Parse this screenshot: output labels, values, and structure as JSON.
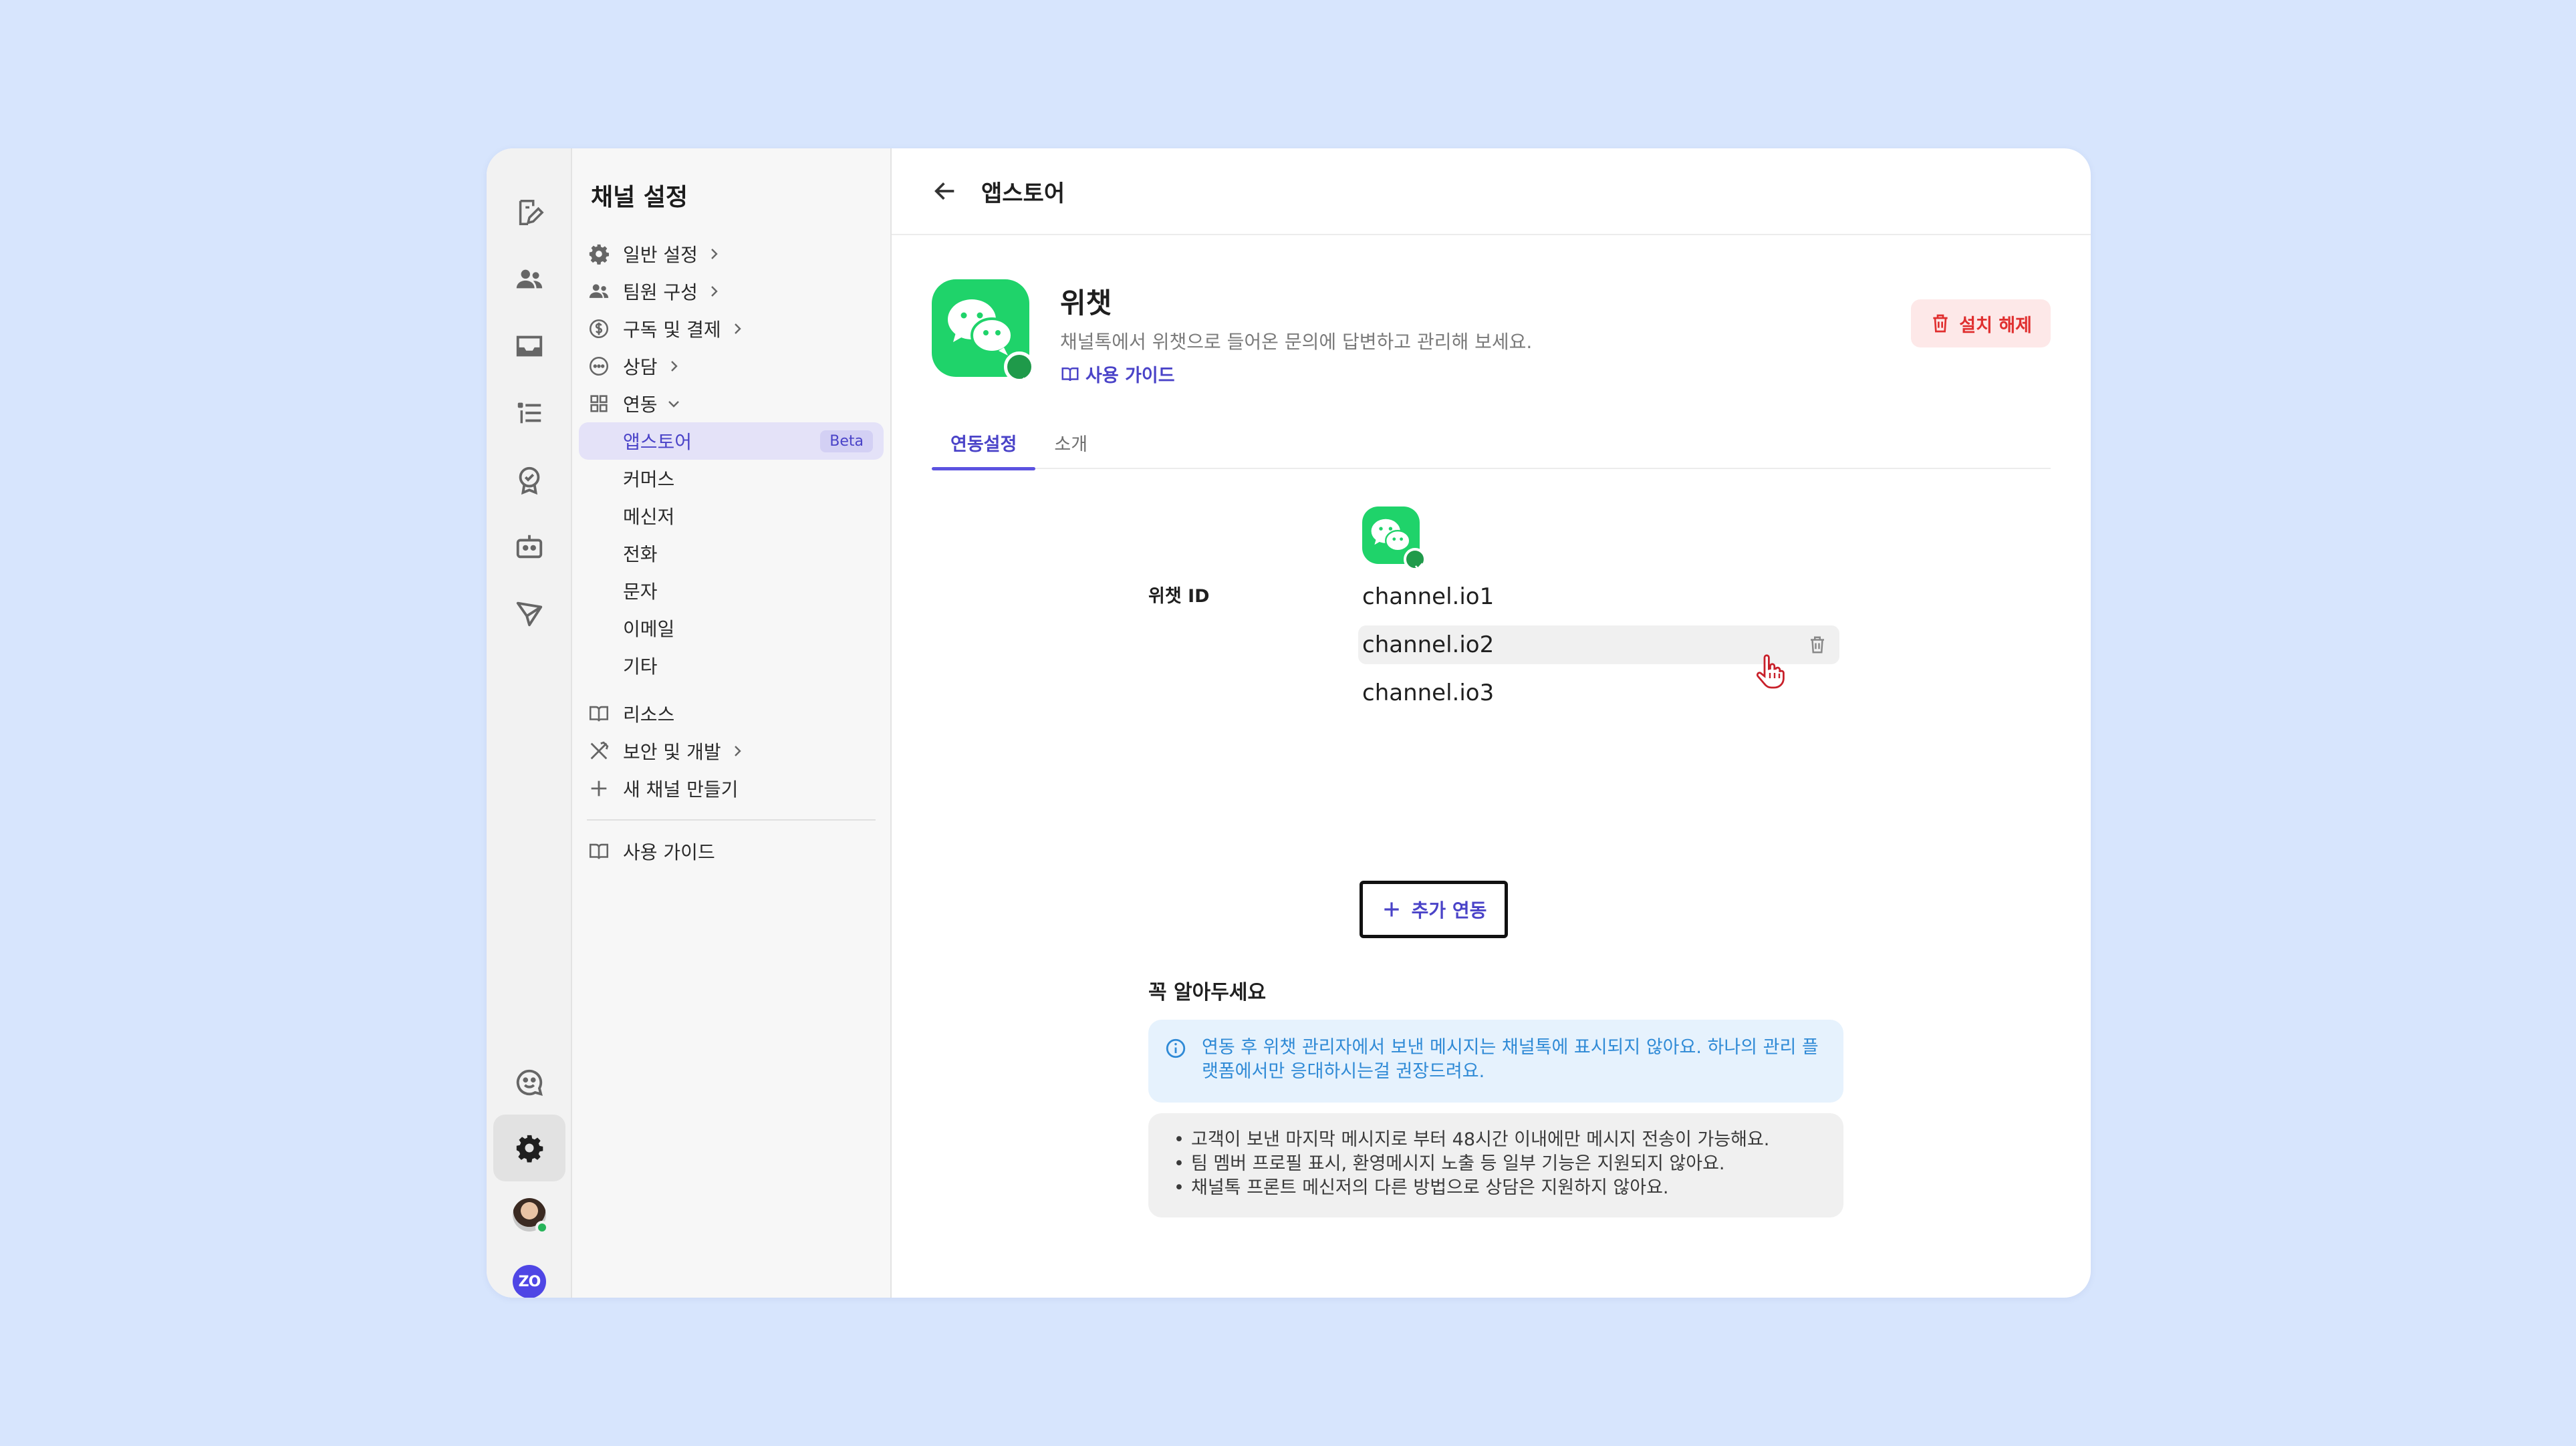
{
  "sidebar": {
    "title": "채널 설정",
    "items": [
      {
        "label": "일반 설정"
      },
      {
        "label": "팀원 구성"
      },
      {
        "label": "구독 및 결제"
      },
      {
        "label": "상담"
      },
      {
        "label": "연동"
      }
    ],
    "sub_items": [
      {
        "label": "앱스토어",
        "badge": "Beta"
      },
      {
        "label": "커머스"
      },
      {
        "label": "메신저"
      },
      {
        "label": "전화"
      },
      {
        "label": "문자"
      },
      {
        "label": "이메일"
      },
      {
        "label": "기타"
      }
    ],
    "lower_items": [
      {
        "label": "리소스"
      },
      {
        "label": "보안 및 개발"
      },
      {
        "label": "새 채널 만들기"
      }
    ],
    "guide_label": "사용 가이드"
  },
  "topbar": {
    "title": "앱스토어"
  },
  "app": {
    "name": "위챗",
    "description": "채널톡에서 위챗으로 들어온 문의에 답변하고 관리해 보세요.",
    "guide_link": "사용 가이드",
    "uninstall_label": "설치 해제"
  },
  "tabs": [
    {
      "label": "연동설정",
      "active": true
    },
    {
      "label": "소개",
      "active": false
    }
  ],
  "form": {
    "field_label": "위챗 ID",
    "ids": [
      "channel.io1",
      "channel.io2",
      "channel.io3"
    ],
    "add_button": "추가 연동"
  },
  "notice": {
    "title": "꼭 알아두세요",
    "info": "연동 후 위챗 관리자에서 보낸 메시지는 채널톡에 표시되지 않아요. 하나의 관리 플랫폼에서만 응대하시는걸 권장드려요.",
    "bullets": [
      "고객이 보낸 마지막 메시지로 부터 48시간 이내에만 메시지 전송이 가능해요.",
      "팀 멤버 프로필 표시, 환영메시지 노출 등 일부 기능은 지원되지 않아요.",
      "채널톡 프론트 메신저의 다른 방법으로 상담은 지원하지 않아요."
    ]
  },
  "rail": {
    "avatar_text": "ZO"
  },
  "colors": {
    "accent": "#4a43c8",
    "wechat_green": "#1fd36a",
    "danger": "#e02f2f",
    "info": "#2f8ad6"
  }
}
